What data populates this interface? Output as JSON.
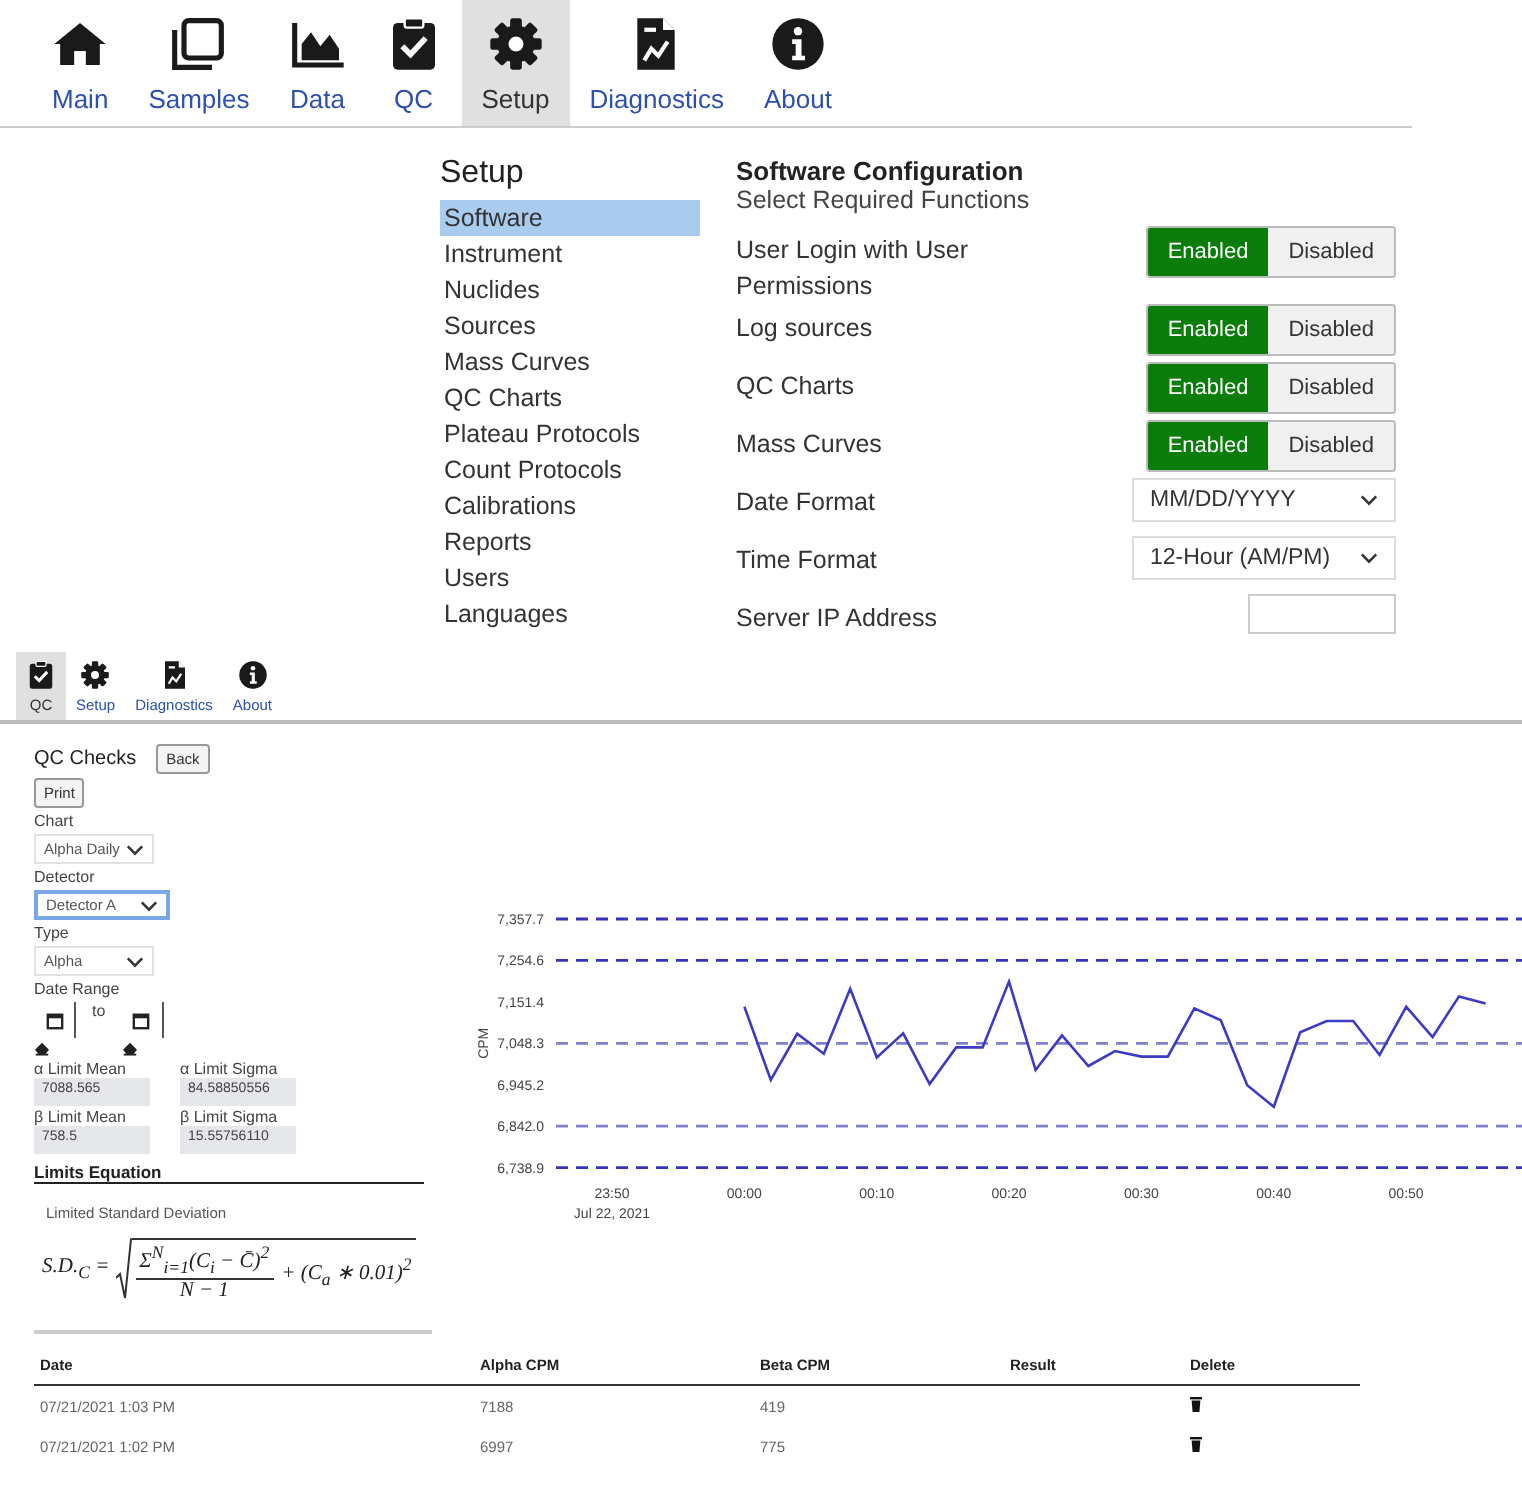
{
  "top_nav": {
    "items": [
      {
        "label": "Main",
        "kind": "home",
        "selected": false
      },
      {
        "label": "Samples",
        "kind": "copy",
        "selected": false
      },
      {
        "label": "Data",
        "kind": "chart",
        "selected": false
      },
      {
        "label": "QC",
        "kind": "clipboard",
        "selected": false
      },
      {
        "label": "Setup",
        "kind": "gear",
        "selected": true
      },
      {
        "label": "Diagnostics",
        "kind": "report",
        "selected": false
      },
      {
        "label": "About",
        "kind": "info",
        "selected": false
      }
    ]
  },
  "setup_menu": {
    "title": "Setup",
    "items": [
      {
        "label": "Software",
        "selected": true
      },
      {
        "label": "Instrument",
        "selected": false
      },
      {
        "label": "Nuclides",
        "selected": false
      },
      {
        "label": "Sources",
        "selected": false
      },
      {
        "label": "Mass Curves",
        "selected": false
      },
      {
        "label": "QC Charts",
        "selected": false
      },
      {
        "label": "Plateau Protocols",
        "selected": false
      },
      {
        "label": "Count Protocols",
        "selected": false
      },
      {
        "label": "Calibrations",
        "selected": false
      },
      {
        "label": "Reports",
        "selected": false
      },
      {
        "label": "Users",
        "selected": false
      },
      {
        "label": "Languages",
        "selected": false
      }
    ]
  },
  "config": {
    "title": "Software Configuration",
    "subtitle": "Select Required Functions",
    "rows": [
      {
        "kind": "toggle",
        "label": "User Login with User Permissions",
        "enabled": true,
        "on_label": "Enabled",
        "off_label": "Disabled"
      },
      {
        "kind": "toggle",
        "label": "Log sources",
        "enabled": true,
        "on_label": "Enabled",
        "off_label": "Disabled"
      },
      {
        "kind": "toggle",
        "label": "QC Charts",
        "enabled": true,
        "on_label": "Enabled",
        "off_label": "Disabled"
      },
      {
        "kind": "toggle",
        "label": "Mass Curves",
        "enabled": true,
        "on_label": "Enabled",
        "off_label": "Disabled"
      },
      {
        "kind": "select",
        "label": "Date Format",
        "value": "MM/DD/YYYY"
      },
      {
        "kind": "select",
        "label": "Time Format",
        "value": "12-Hour (AM/PM)"
      },
      {
        "kind": "field",
        "label": "Server IP Address"
      }
    ]
  },
  "qc_nav": {
    "items": [
      {
        "label": "QC",
        "kind": "clipboard",
        "selected": true
      },
      {
        "label": "Setup",
        "kind": "gear",
        "selected": false
      },
      {
        "label": "Diagnostics",
        "kind": "report",
        "selected": false
      },
      {
        "label": "About",
        "kind": "info",
        "selected": false
      }
    ]
  },
  "qc_panel": {
    "title": "QC Checks",
    "back_button": "Back",
    "print_button": "Print",
    "selects": [
      {
        "label": "Chart",
        "value": "Alpha Daily",
        "focused": false
      },
      {
        "label": "Detector",
        "value": "Detector A",
        "focused": true
      },
      {
        "label": "Type",
        "value": "Alpha",
        "focused": false
      }
    ],
    "date_range": {
      "label": "Date Range",
      "separator": "to"
    },
    "limits": [
      {
        "label": "α Limit Mean",
        "value": "7088.565"
      },
      {
        "label": "α Limit Sigma",
        "value": "84.58850556"
      },
      {
        "label": "β Limit Mean",
        "value": "758.5"
      },
      {
        "label": "β Limit Sigma",
        "value": "15.55756110"
      }
    ],
    "equation": {
      "title": "Limits Equation",
      "caption": "Limited Standard Deviation",
      "lhs": "S.D.$_{C}$ =",
      "numerator": "Σ$^{N}$$_{i=1}$(C$_{i}$ − C̄)$^{2}$",
      "denominator": "N − 1",
      "tail": "+ (C$_{a}$ ∗ 0.01)$^{2}$"
    }
  },
  "chart": {
    "date_label": "Jul 22, 2021",
    "chart_data": {
      "type": "line",
      "ylabel": "CPM",
      "categories": [
        "23:50",
        null,
        null,
        null,
        null,
        "00:00",
        null,
        null,
        null,
        null,
        "00:10",
        null,
        null,
        null,
        null,
        "00:20",
        null,
        null,
        null,
        null,
        "00:30",
        null,
        null,
        null,
        null,
        "00:40",
        null,
        null,
        null,
        null,
        "00:50",
        null,
        null,
        null,
        null
      ],
      "series": [
        {
          "color": "#3b3bc4",
          "values": [
            null,
            null,
            null,
            null,
            null,
            7139,
            6957,
            7072,
            7022,
            7184,
            7013,
            7073,
            6947,
            7038,
            7038,
            7202,
            6982,
            7068,
            6992,
            7029,
            7015,
            7015,
            7135,
            7106,
            6944,
            6890,
            7076,
            7104,
            7104,
            7019,
            7139,
            7064,
            7165,
            7147,
            null
          ]
        }
      ],
      "ylim": [
        6738.9,
        7357.7
      ],
      "yticks": [
        {
          "value": 7357.7,
          "label": "7,357.7"
        },
        {
          "value": 7254.6,
          "label": "7,254.6"
        },
        {
          "value": 7151.4,
          "label": "7,151.4"
        },
        {
          "value": 7048.3,
          "label": "7,048.3"
        },
        {
          "value": 6945.2,
          "label": "6,945.2"
        },
        {
          "value": 6842.0,
          "label": "6,842.0"
        },
        {
          "value": 6738.9,
          "label": "6,738.9"
        }
      ],
      "ref_lines": [
        {
          "axis": "y",
          "value": 7357.7,
          "color": "#3333bb"
        },
        {
          "axis": "y",
          "value": 7254.6,
          "color": "#3333bb"
        },
        {
          "axis": "y",
          "value": 7048.3,
          "color": "#8080d0"
        },
        {
          "axis": "y",
          "value": 6842.0,
          "color": "#8080d0"
        },
        {
          "axis": "y",
          "value": 6738.9,
          "color": "#3333bb"
        }
      ]
    }
  },
  "results_table": {
    "columns": [
      "Date",
      "Alpha CPM",
      "Beta CPM",
      "Result",
      "Delete"
    ],
    "rows": [
      {
        "date": "07/21/2021 1:03 PM",
        "alpha": "7188",
        "beta": "419"
      },
      {
        "date": "07/21/2021 1:02 PM",
        "alpha": "6997",
        "beta": "775"
      }
    ]
  }
}
